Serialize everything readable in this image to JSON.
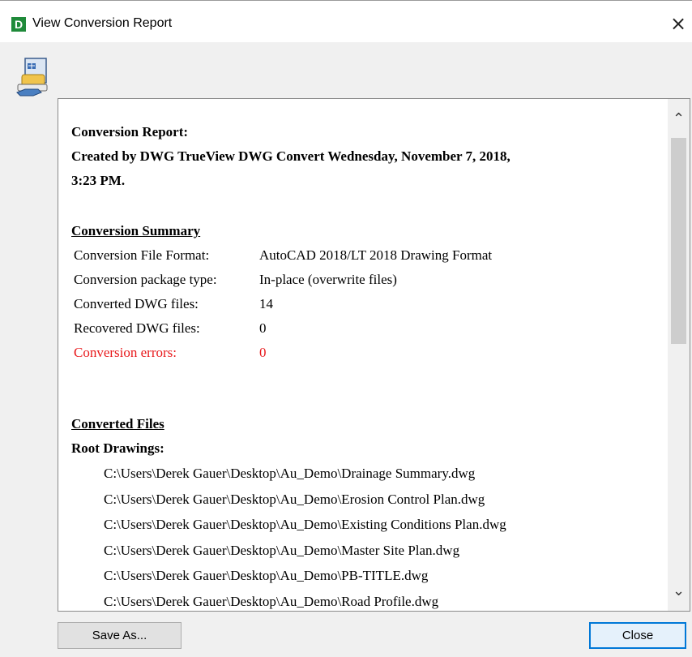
{
  "window": {
    "title": "View Conversion Report",
    "app_icon_letter": "D",
    "close_glyph": "×"
  },
  "report": {
    "heading_line1": "Conversion Report:",
    "heading_line2": "Created by DWG TrueView DWG Convert Wednesday, November 7, 2018,",
    "heading_line3": "3:23 PM.",
    "summary_title": "Conversion Summary",
    "summary": [
      {
        "label": "Conversion File Format:",
        "value": "AutoCAD 2018/LT 2018 Drawing Format"
      },
      {
        "label": "Conversion package type:",
        "value": "In-place (overwrite files)"
      },
      {
        "label": "Converted DWG files:",
        "value": "14"
      },
      {
        "label": "Recovered DWG files:",
        "value": "0"
      },
      {
        "label": "Conversion errors:",
        "value": "0"
      }
    ],
    "converted_title": "Converted Files",
    "root_drawings_label": "Root Drawings:",
    "files": [
      "C:\\Users\\Derek Gauer\\Desktop\\Au_Demo\\Drainage Summary.dwg",
      "C:\\Users\\Derek Gauer\\Desktop\\Au_Demo\\Erosion Control Plan.dwg",
      "C:\\Users\\Derek Gauer\\Desktop\\Au_Demo\\Existing Conditions Plan.dwg",
      "C:\\Users\\Derek Gauer\\Desktop\\Au_Demo\\Master Site Plan.dwg",
      "C:\\Users\\Derek Gauer\\Desktop\\Au_Demo\\PB-TITLE.dwg",
      "C:\\Users\\Derek Gauer\\Desktop\\Au_Demo\\Road Profile.dwg"
    ]
  },
  "scrollbar": {
    "up_glyph": "⌃",
    "down_glyph": "⌄"
  },
  "buttons": {
    "save_as": "Save As...",
    "close": "Close"
  },
  "colors": {
    "error_text": "#e8191c",
    "app_icon_bg": "#1f8a3a",
    "focus_border": "#0078d7"
  },
  "icons": {
    "app": "dwg-trueview-icon",
    "report": "report-document-icon"
  }
}
